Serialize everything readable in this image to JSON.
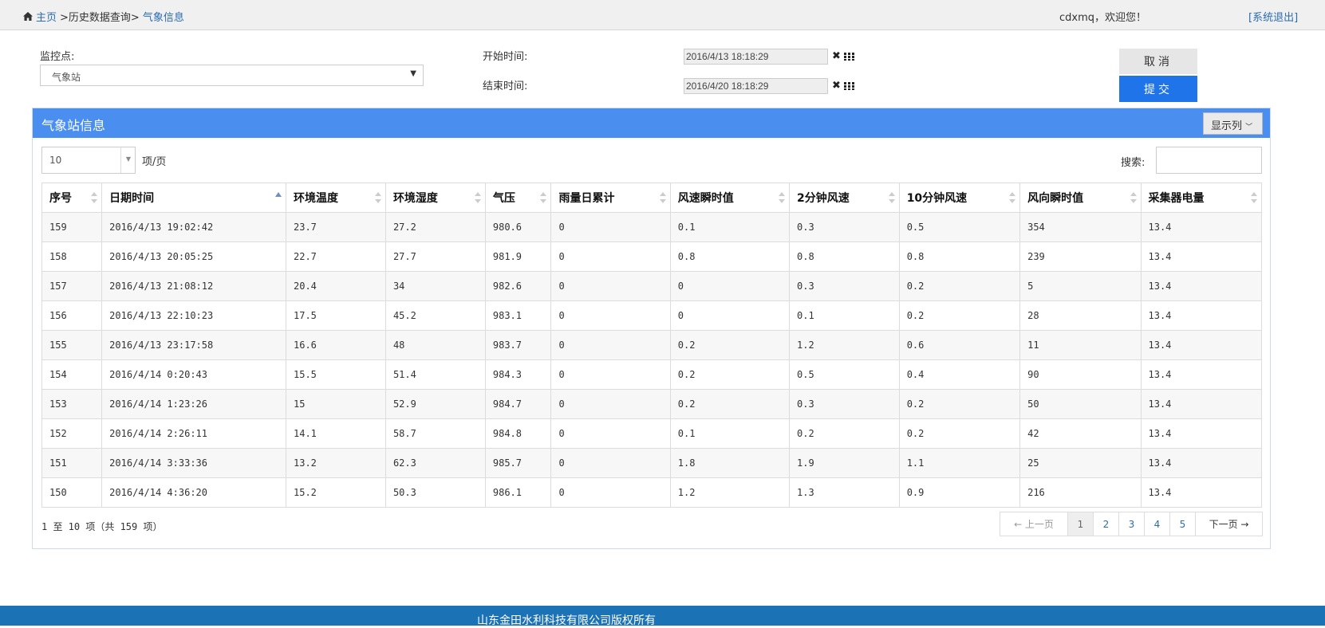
{
  "breadcrumb": {
    "home": "主页",
    "mid": ">历史数据查询>",
    "current": "气象信息"
  },
  "user": {
    "welcome": "cdxmq，欢迎您！",
    "logout": "[系统退出]"
  },
  "filters": {
    "station_label": "监控点:",
    "station_value": "气象站",
    "start_label": "开始时间:",
    "start_value": "2016/4/13 18:18:29",
    "end_label": "结束时间:",
    "end_value": "2016/4/20 18:18:29",
    "cancel": "取消",
    "submit": "提交"
  },
  "panel": {
    "title": "气象站信息",
    "columns_btn": "显示列"
  },
  "table_controls": {
    "page_size": "10",
    "page_size_suffix": "项/页",
    "search_label": "搜索:"
  },
  "table": {
    "headers": [
      "序号",
      "日期时间",
      "环境温度",
      "环境湿度",
      "气压",
      "雨量日累计",
      "风速瞬时值",
      "2分钟风速",
      "10分钟风速",
      "风向瞬时值",
      "采集器电量"
    ],
    "rows": [
      [
        "159",
        "2016/4/13 19:02:42",
        "23.7",
        "27.2",
        "980.6",
        "0",
        "0.1",
        "0.3",
        "0.5",
        "354",
        "13.4"
      ],
      [
        "158",
        "2016/4/13 20:05:25",
        "22.7",
        "27.7",
        "981.9",
        "0",
        "0.8",
        "0.8",
        "0.8",
        "239",
        "13.4"
      ],
      [
        "157",
        "2016/4/13 21:08:12",
        "20.4",
        "34",
        "982.6",
        "0",
        "0",
        "0.3",
        "0.2",
        "5",
        "13.4"
      ],
      [
        "156",
        "2016/4/13 22:10:23",
        "17.5",
        "45.2",
        "983.1",
        "0",
        "0",
        "0.1",
        "0.2",
        "28",
        "13.4"
      ],
      [
        "155",
        "2016/4/13 23:17:58",
        "16.6",
        "48",
        "983.7",
        "0",
        "0.2",
        "1.2",
        "0.6",
        "11",
        "13.4"
      ],
      [
        "154",
        "2016/4/14 0:20:43",
        "15.5",
        "51.4",
        "984.3",
        "0",
        "0.2",
        "0.5",
        "0.4",
        "90",
        "13.4"
      ],
      [
        "153",
        "2016/4/14 1:23:26",
        "15",
        "52.9",
        "984.7",
        "0",
        "0.2",
        "0.3",
        "0.2",
        "50",
        "13.4"
      ],
      [
        "152",
        "2016/4/14 2:26:11",
        "14.1",
        "58.7",
        "984.8",
        "0",
        "0.1",
        "0.2",
        "0.2",
        "42",
        "13.4"
      ],
      [
        "151",
        "2016/4/14 3:33:36",
        "13.2",
        "62.3",
        "985.7",
        "0",
        "1.8",
        "1.9",
        "1.1",
        "25",
        "13.4"
      ],
      [
        "150",
        "2016/4/14 4:36:20",
        "15.2",
        "50.3",
        "986.1",
        "0",
        "1.2",
        "1.3",
        "0.9",
        "216",
        "13.4"
      ]
    ]
  },
  "pagination": {
    "info": "1 至 10 项（共 159 项）",
    "prev": "← 上一页",
    "pages": [
      "1",
      "2",
      "3",
      "4",
      "5"
    ],
    "next": "下一页 →"
  },
  "footer": {
    "text": "山东金田水利科技有限公司版权所有"
  },
  "colors": {
    "header_blue": "#4a8ff0",
    "submit_blue": "#1e74e8",
    "footer_blue": "#1b72b5",
    "link": "#2b6cb0"
  }
}
